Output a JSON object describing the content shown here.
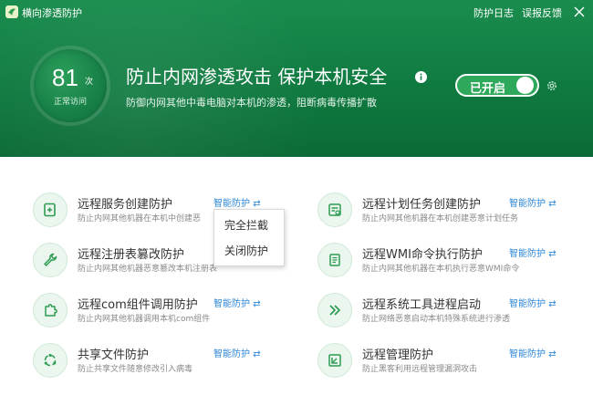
{
  "window": {
    "title": "横向渗透防护",
    "links": {
      "log": "防护日志",
      "feedback": "误报反馈"
    }
  },
  "header": {
    "score": {
      "value": "81",
      "unit": "次",
      "label": "正常访问"
    },
    "headline": "防止内网渗透攻击 保护本机安全",
    "subline": "防御内网其他中毒电脑对本机的渗透，阻断病毒传播扩散",
    "toggle": {
      "label": "已开启",
      "state": "on"
    }
  },
  "colors": {
    "brand": "#16824a",
    "accent": "#2f88d8",
    "toggle_on": "#2ea85a"
  },
  "items_left": [
    {
      "title": "远程服务创建防护",
      "desc": "防止内网其他机器在本机中创建恶",
      "mode": "智能防护",
      "icon": "service-plus-icon"
    },
    {
      "title": "远程注册表篡改防护",
      "desc": "防止内网其他机器恶意篡改本机注册表",
      "mode": "",
      "icon": "wrench-icon"
    },
    {
      "title": "远程com组件调用防护",
      "desc": "防止内网其他机器调用本机com组件",
      "mode": "智能防护",
      "icon": "puzzle-icon"
    },
    {
      "title": "共享文件防护",
      "desc": "防止共享文件随意修改引入病毒",
      "mode": "智能防护",
      "icon": "share-icon"
    }
  ],
  "items_right": [
    {
      "title": "远程计划任务创建防护",
      "desc": "防止内网其他机器在本机创建恶意计划任务",
      "mode": "智能防护",
      "icon": "task-icon"
    },
    {
      "title": "远程WMI命令执行防护",
      "desc": "防止内网其他机器在本机执行恶意WMI命令",
      "mode": "智能防护",
      "icon": "wmi-icon"
    },
    {
      "title": "远程系统工具进程启动",
      "desc": "防止网络恶意启动本机特殊系统进行渗透",
      "mode": "智能防护",
      "icon": "tool-icon"
    },
    {
      "title": "远程管理防护",
      "desc": "防止黑客利用远程管理漏洞攻击",
      "mode": "智能防护",
      "icon": "remote-icon"
    }
  ],
  "dropdown": {
    "options": [
      "完全拦截",
      "关闭防护"
    ]
  }
}
